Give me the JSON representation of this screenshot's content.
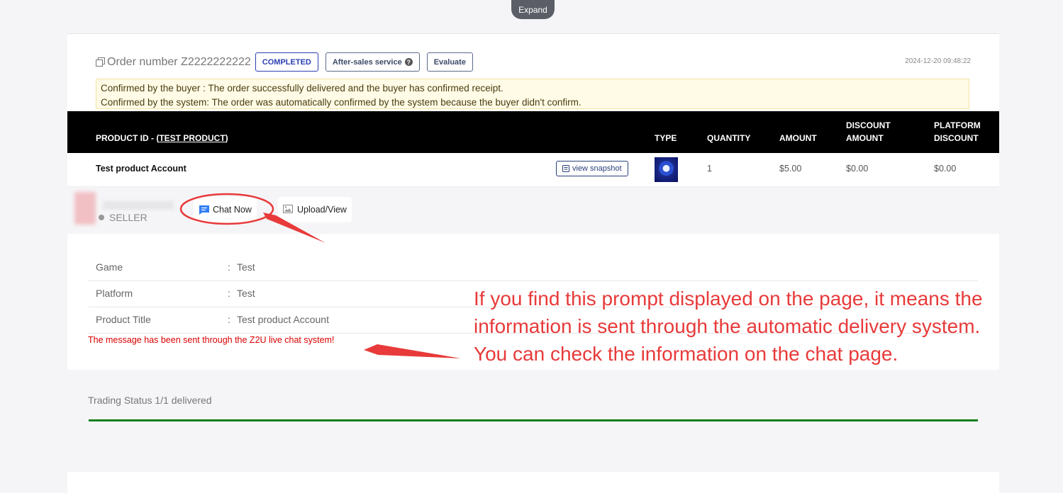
{
  "top": {
    "expand_label": "Expand"
  },
  "order": {
    "number_label": "Order number Z2222222222",
    "status": "COMPLETED",
    "after_sales_label": "After-sales service",
    "evaluate_label": "Evaluate",
    "date": "2024-12-20 09:48:22"
  },
  "notice": {
    "line1": "Confirmed by the buyer : The order successfully delivered and the buyer has confirmed receipt.",
    "line2": "Confirmed by the system: The order was automatically confirmed by the system because the buyer didn't confirm."
  },
  "table": {
    "headers": {
      "product_id_prefix": "PRODUCT ID - (",
      "product_id_link": "TEST PRODUCT",
      "product_id_suffix": ")",
      "type": "TYPE",
      "quantity": "QUANTITY",
      "amount": "AMOUNT",
      "discount_1": "DISCOUNT",
      "discount_2": "AMOUNT",
      "platform_1": "PLATFORM",
      "platform_2": "DISCOUNT"
    },
    "row": {
      "name": "Test product Account",
      "snapshot_label": "view snapshot",
      "quantity": "1",
      "amount": "$5.00",
      "discount": "$0.00",
      "platform_discount": "$0.00"
    }
  },
  "seller": {
    "label": "SELLER",
    "chat_label": "Chat Now",
    "upload_label": "Upload/View"
  },
  "details": [
    {
      "key": "Game",
      "sep": ":",
      "value": "Test"
    },
    {
      "key": "Platform",
      "sep": ":",
      "value": "Test"
    },
    {
      "key": "Product Title",
      "sep": ":",
      "value": "Test product Account"
    }
  ],
  "system_message": "The message has been sent through the Z2U live chat system!",
  "trading_status": "Trading Status 1/1 delivered",
  "annotation": {
    "line1": "If you find this prompt displayed on the page, it means the",
    "line2": "information is sent through the automatic delivery system.",
    "line3": "You can check the information on the chat page."
  },
  "colors": {
    "accent_red": "#e83a3a",
    "status_green": "#137f1f",
    "header_black": "#000000"
  },
  "icons": [
    "copy-icon",
    "help-icon",
    "snapshot-icon",
    "chat-icon",
    "image-icon"
  ]
}
